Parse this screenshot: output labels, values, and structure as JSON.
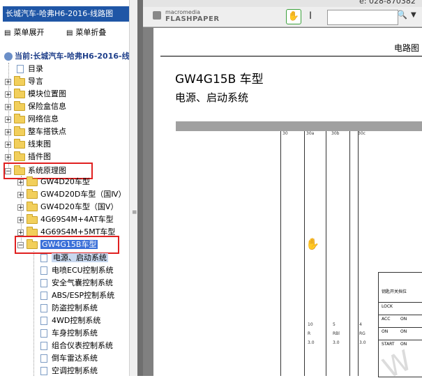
{
  "sidebar": {
    "title": "长城汽车-哈弗H6-2016-线路图",
    "expand_label": "菜单展开",
    "collapse_label": "菜单折叠",
    "root_label": "当前:长城汽车-哈弗H6-2016-线路",
    "items": [
      {
        "label": "目录"
      },
      {
        "label": "导言"
      },
      {
        "label": "模块位置图"
      },
      {
        "label": "保险盒信息"
      },
      {
        "label": "网络信息"
      },
      {
        "label": "整车搭铁点"
      },
      {
        "label": "线束图"
      },
      {
        "label": "插件图"
      },
      {
        "label": "系统原理图"
      }
    ],
    "sub_items": [
      {
        "label": "GW4D20车型"
      },
      {
        "label": "GW4D20D车型（国Ⅳ）"
      },
      {
        "label": "GW4D20车型（国Ⅴ）"
      },
      {
        "label": "4G69S4M+4AT车型"
      },
      {
        "label": "4G69S4M+5MT车型"
      },
      {
        "label": "GW4G15B车型"
      }
    ],
    "leaf_items": [
      {
        "label": "电源、启动系统"
      },
      {
        "label": "电喷ECU控制系统"
      },
      {
        "label": "安全气囊控制系统"
      },
      {
        "label": "ABS/ESP控制系统"
      },
      {
        "label": "防盗控制系统"
      },
      {
        "label": "4WD控制系统"
      },
      {
        "label": "车身控制系统"
      },
      {
        "label": "组合仪表控制系统"
      },
      {
        "label": "倒车雷达系统"
      },
      {
        "label": "空调控制系统"
      }
    ]
  },
  "viewer": {
    "top_text": "ё: 028-870382",
    "brand_small": "macromedia",
    "brand_big": "FLASHPAPER",
    "search_placeholder": "",
    "page": {
      "header": "电路图",
      "model_title": "GW4G15B 车型",
      "system_title": "电源、启动系统",
      "columns": [
        "30",
        "30a",
        "30b",
        "30c"
      ],
      "pins": [
        {
          "num": "10",
          "name": "R",
          "size": "3.0"
        },
        {
          "num": "5",
          "name": "RBl",
          "size": "3.0"
        },
        {
          "num": "4",
          "name": "RG",
          "size": "3.0"
        }
      ],
      "ign_header": "钥匙开关挡位",
      "ign_rows": [
        {
          "pos": "LOCK",
          "state": ""
        },
        {
          "pos": "ACC",
          "state": "ON"
        },
        {
          "pos": "ON",
          "state": "ON"
        },
        {
          "pos": "START",
          "state": "ON"
        }
      ],
      "watermark": "W"
    }
  }
}
